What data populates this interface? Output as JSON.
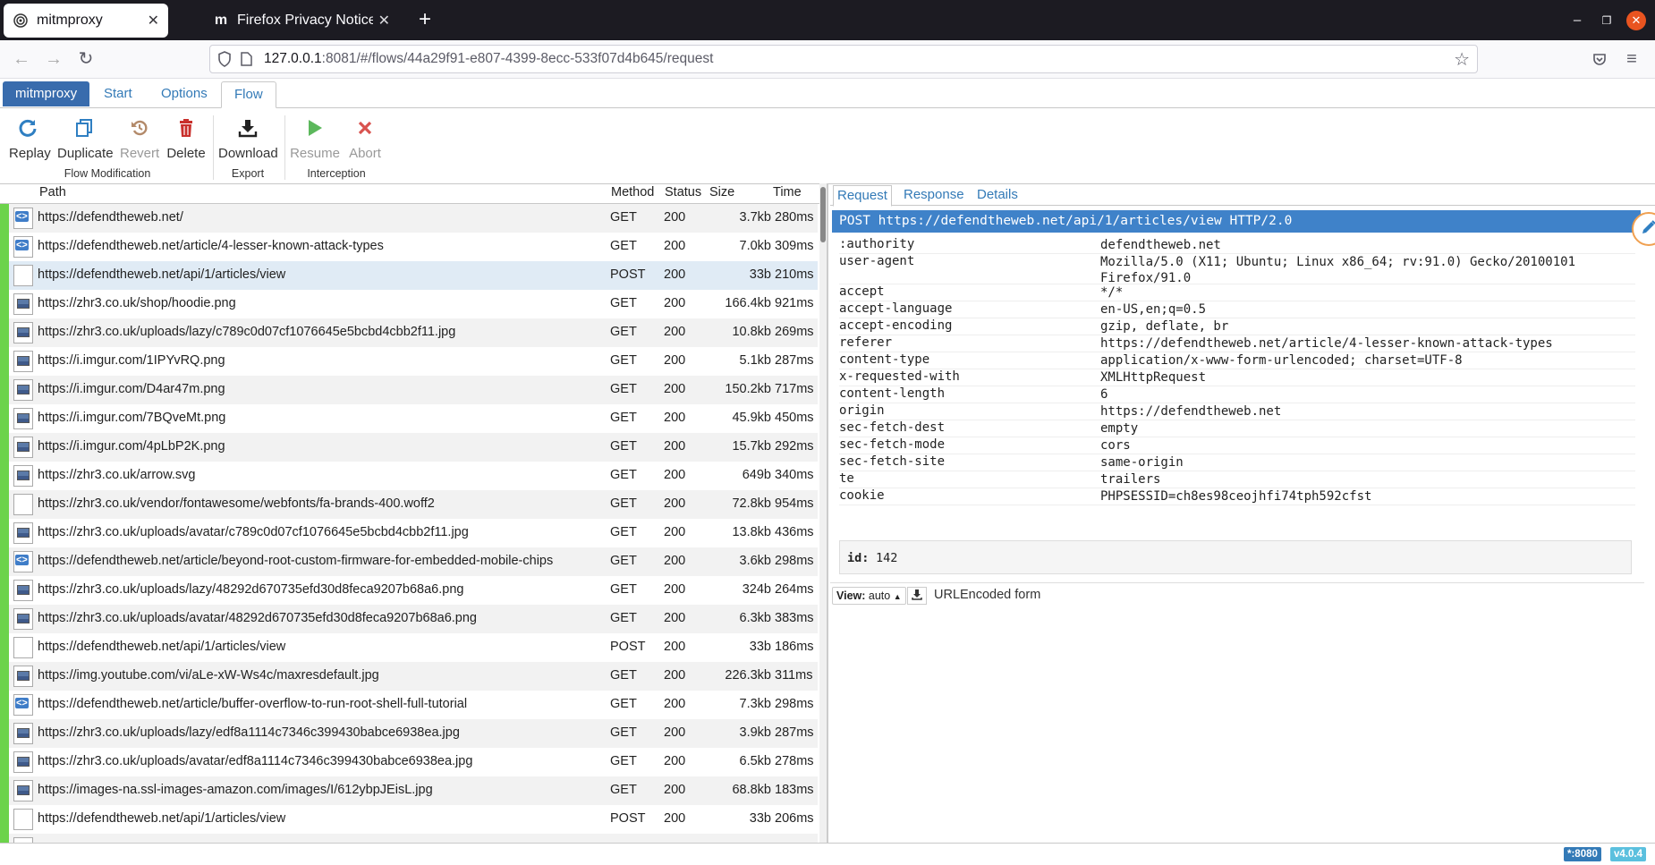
{
  "browser": {
    "tabs": [
      {
        "title": "mitmproxy",
        "icon": "mitmproxy-favicon"
      },
      {
        "title": "Firefox Privacy Notice —",
        "icon": "mozilla-favicon"
      }
    ],
    "url_host": "127.0.0.1",
    "url_rest": ":8081/#/flows/44a29f91-e807-4399-8ecc-533f07d4b645/request"
  },
  "mitm_tabs": [
    "mitmproxy",
    "Start",
    "Options",
    "Flow"
  ],
  "toolbar": {
    "replay": "Replay",
    "duplicate": "Duplicate",
    "revert": "Revert",
    "delete": "Delete",
    "download": "Download",
    "resume": "Resume",
    "abort": "Abort",
    "groups": {
      "flow_modification": "Flow Modification",
      "export": "Export",
      "interception": "Interception"
    }
  },
  "flow_columns": {
    "path": "Path",
    "method": "Method",
    "status": "Status",
    "size": "Size",
    "time": "Time"
  },
  "flows": [
    {
      "icon": "html",
      "path": "https://defendtheweb.net/",
      "method": "GET",
      "status": "200",
      "size": "3.7kb",
      "time": "280ms"
    },
    {
      "icon": "html",
      "path": "https://defendtheweb.net/article/4-lesser-known-attack-types",
      "method": "GET",
      "status": "200",
      "size": "7.0kb",
      "time": "309ms"
    },
    {
      "icon": "plain",
      "path": "https://defendtheweb.net/api/1/articles/view",
      "method": "POST",
      "status": "200",
      "size": "33b",
      "time": "210ms"
    },
    {
      "icon": "img",
      "path": "https://zhr3.co.uk/shop/hoodie.png",
      "method": "GET",
      "status": "200",
      "size": "166.4kb",
      "time": "921ms"
    },
    {
      "icon": "img",
      "path": "https://zhr3.co.uk/uploads/lazy/c789c0d07cf1076645e5bcbd4cbb2f11.jpg",
      "method": "GET",
      "status": "200",
      "size": "10.8kb",
      "time": "269ms"
    },
    {
      "icon": "img",
      "path": "https://i.imgur.com/1IPYvRQ.png",
      "method": "GET",
      "status": "200",
      "size": "5.1kb",
      "time": "287ms"
    },
    {
      "icon": "img",
      "path": "https://i.imgur.com/D4ar47m.png",
      "method": "GET",
      "status": "200",
      "size": "150.2kb",
      "time": "717ms"
    },
    {
      "icon": "img",
      "path": "https://i.imgur.com/7BQveMt.png",
      "method": "GET",
      "status": "200",
      "size": "45.9kb",
      "time": "450ms"
    },
    {
      "icon": "img",
      "path": "https://i.imgur.com/4pLbP2K.png",
      "method": "GET",
      "status": "200",
      "size": "15.7kb",
      "time": "292ms"
    },
    {
      "icon": "img",
      "path": "https://zhr3.co.uk/arrow.svg",
      "method": "GET",
      "status": "200",
      "size": "649b",
      "time": "340ms"
    },
    {
      "icon": "plain",
      "path": "https://zhr3.co.uk/vendor/fontawesome/webfonts/fa-brands-400.woff2",
      "method": "GET",
      "status": "200",
      "size": "72.8kb",
      "time": "954ms"
    },
    {
      "icon": "img",
      "path": "https://zhr3.co.uk/uploads/avatar/c789c0d07cf1076645e5bcbd4cbb2f11.jpg",
      "method": "GET",
      "status": "200",
      "size": "13.8kb",
      "time": "436ms"
    },
    {
      "icon": "html",
      "path": "https://defendtheweb.net/article/beyond-root-custom-firmware-for-embedded-mobile-chips",
      "method": "GET",
      "status": "200",
      "size": "3.6kb",
      "time": "298ms"
    },
    {
      "icon": "img",
      "path": "https://zhr3.co.uk/uploads/lazy/48292d670735efd30d8feca9207b68a6.png",
      "method": "GET",
      "status": "200",
      "size": "324b",
      "time": "264ms"
    },
    {
      "icon": "img",
      "path": "https://zhr3.co.uk/uploads/avatar/48292d670735efd30d8feca9207b68a6.png",
      "method": "GET",
      "status": "200",
      "size": "6.3kb",
      "time": "383ms"
    },
    {
      "icon": "plain",
      "path": "https://defendtheweb.net/api/1/articles/view",
      "method": "POST",
      "status": "200",
      "size": "33b",
      "time": "186ms"
    },
    {
      "icon": "img",
      "path": "https://img.youtube.com/vi/aLe-xW-Ws4c/maxresdefault.jpg",
      "method": "GET",
      "status": "200",
      "size": "226.3kb",
      "time": "311ms"
    },
    {
      "icon": "html",
      "path": "https://defendtheweb.net/article/buffer-overflow-to-run-root-shell-full-tutorial",
      "method": "GET",
      "status": "200",
      "size": "7.3kb",
      "time": "298ms"
    },
    {
      "icon": "img",
      "path": "https://zhr3.co.uk/uploads/lazy/edf8a1114c7346c399430babce6938ea.jpg",
      "method": "GET",
      "status": "200",
      "size": "3.9kb",
      "time": "287ms"
    },
    {
      "icon": "img",
      "path": "https://zhr3.co.uk/uploads/avatar/edf8a1114c7346c399430babce6938ea.jpg",
      "method": "GET",
      "status": "200",
      "size": "6.5kb",
      "time": "278ms"
    },
    {
      "icon": "img",
      "path": "https://images-na.ssl-images-amazon.com/images/I/612ybpJEisL.jpg",
      "method": "GET",
      "status": "200",
      "size": "68.8kb",
      "time": "183ms"
    },
    {
      "icon": "plain",
      "path": "https://defendtheweb.net/api/1/articles/view",
      "method": "POST",
      "status": "200",
      "size": "33b",
      "time": "206ms"
    }
  ],
  "selected_index": 2,
  "detail_tabs": [
    "Request",
    "Response",
    "Details"
  ],
  "request_line": "POST https://defendtheweb.net/api/1/articles/view HTTP/2.0",
  "headers": [
    {
      "k": ":authority",
      "v": "defendtheweb.net"
    },
    {
      "k": "user-agent",
      "v": "Mozilla/5.0 (X11; Ubuntu; Linux x86_64; rv:91.0) Gecko/20100101 Firefox/91.0"
    },
    {
      "k": "accept",
      "v": "*/*"
    },
    {
      "k": "accept-language",
      "v": "en-US,en;q=0.5"
    },
    {
      "k": "accept-encoding",
      "v": "gzip, deflate, br"
    },
    {
      "k": "referer",
      "v": "https://defendtheweb.net/article/4-lesser-known-attack-types"
    },
    {
      "k": "content-type",
      "v": "application/x-www-form-urlencoded; charset=UTF-8"
    },
    {
      "k": "x-requested-with",
      "v": "XMLHttpRequest"
    },
    {
      "k": "content-length",
      "v": "6"
    },
    {
      "k": "origin",
      "v": "https://defendtheweb.net"
    },
    {
      "k": "sec-fetch-dest",
      "v": "empty"
    },
    {
      "k": "sec-fetch-mode",
      "v": "cors"
    },
    {
      "k": "sec-fetch-site",
      "v": "same-origin"
    },
    {
      "k": "te",
      "v": "trailers"
    },
    {
      "k": "cookie",
      "v": "PHPSESSID=ch8es98ceojhfi74tph592cfst"
    }
  ],
  "form": {
    "key": "id:",
    "value": "142"
  },
  "view": {
    "label": "View:",
    "mode": "auto",
    "content_type": "URLEncoded form"
  },
  "footer": {
    "port": "*:8080",
    "version": "v4.0.4"
  },
  "colors": {
    "brand": "#396cad",
    "ok": "#6cd34b",
    "request_bar": "#3f82c9",
    "link": "#337ab7"
  }
}
